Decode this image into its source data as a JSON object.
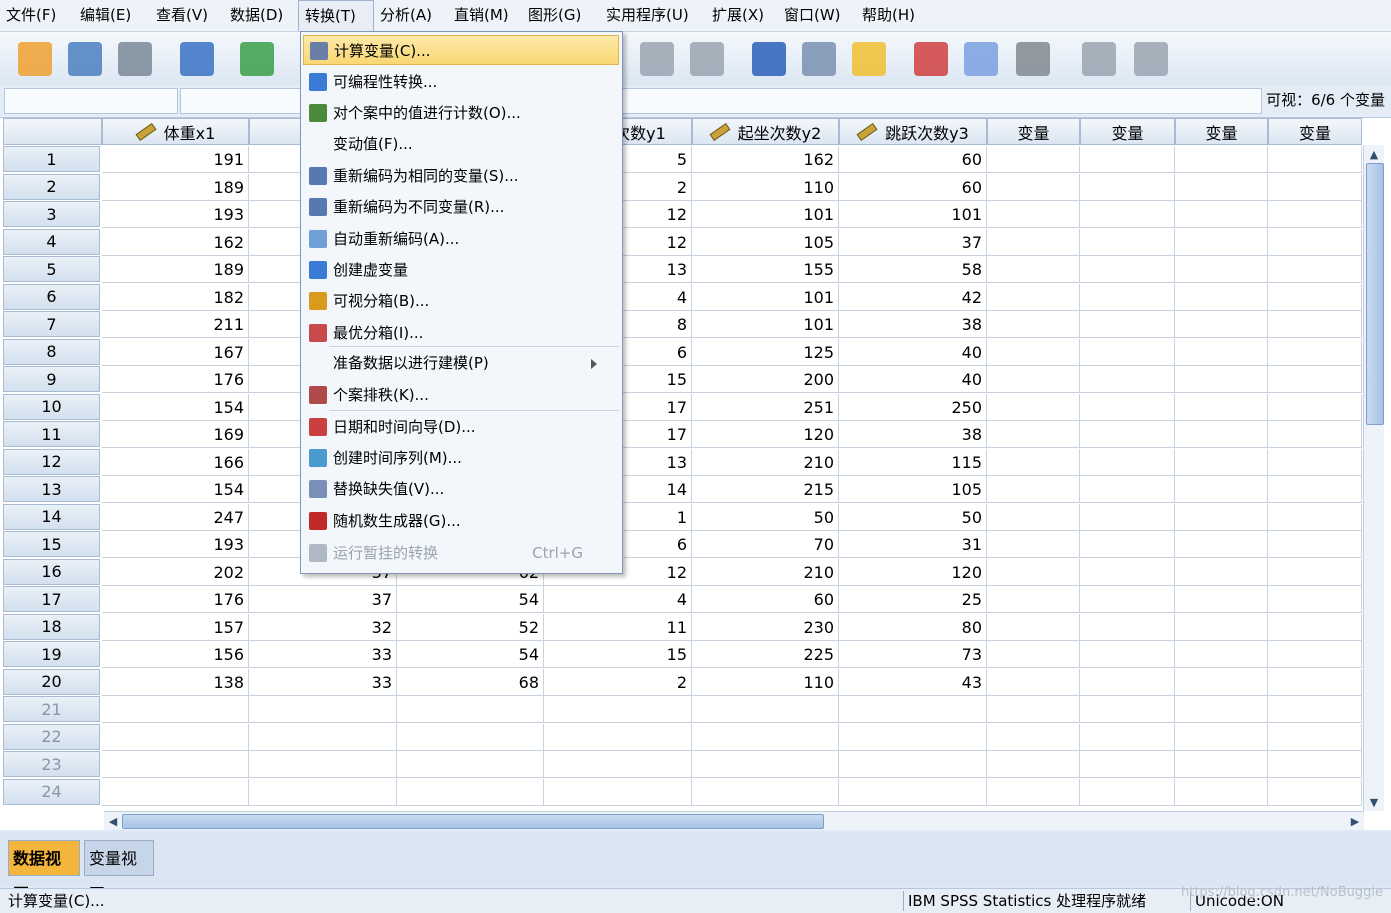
{
  "menubar": [
    {
      "label": "文件(F)"
    },
    {
      "label": "编辑(E)"
    },
    {
      "label": "查看(V)"
    },
    {
      "label": "数据(D)"
    },
    {
      "label": "转换(T)",
      "active": true
    },
    {
      "label": "分析(A)"
    },
    {
      "label": "直销(M)"
    },
    {
      "label": "图形(G)"
    },
    {
      "label": "实用程序(U)"
    },
    {
      "label": "扩展(X)"
    },
    {
      "label": "窗口(W)"
    },
    {
      "label": "帮助(H)"
    }
  ],
  "toolbar_icons": [
    "open-file-icon",
    "save-icon",
    "print-icon",
    "dialog-recall-icon",
    "undo-icon",
    "goto-case-icon",
    "goto-variable-icon",
    "variables-icon",
    "split-file-icon",
    "weight-cases-icon",
    "select-cases-icon",
    "value-labels-icon",
    "use-sets-icon",
    "show-all-icon",
    "spell-check-icon"
  ],
  "cellbar": {
    "visible_count": "可视：6/6 个变量"
  },
  "columns": [
    "体重x1",
    "",
    "",
    "上次数y1",
    "起坐次数y2",
    "跳跃次数y3",
    "变量",
    "变量",
    "变量",
    "变量"
  ],
  "rows": [
    [
      "191",
      "",
      "",
      "5",
      "162",
      "60"
    ],
    [
      "189",
      "",
      "",
      "2",
      "110",
      "60"
    ],
    [
      "193",
      "",
      "",
      "12",
      "101",
      "101"
    ],
    [
      "162",
      "",
      "",
      "12",
      "105",
      "37"
    ],
    [
      "189",
      "",
      "",
      "13",
      "155",
      "58"
    ],
    [
      "182",
      "",
      "",
      "4",
      "101",
      "42"
    ],
    [
      "211",
      "",
      "",
      "8",
      "101",
      "38"
    ],
    [
      "167",
      "",
      "",
      "6",
      "125",
      "40"
    ],
    [
      "176",
      "",
      "",
      "15",
      "200",
      "40"
    ],
    [
      "154",
      "",
      "",
      "17",
      "251",
      "250"
    ],
    [
      "169",
      "",
      "",
      "17",
      "120",
      "38"
    ],
    [
      "166",
      "",
      "",
      "13",
      "210",
      "115"
    ],
    [
      "154",
      "",
      "",
      "14",
      "215",
      "105"
    ],
    [
      "247",
      "",
      "",
      "1",
      "50",
      "50"
    ],
    [
      "193",
      "",
      "",
      "6",
      "70",
      "31"
    ],
    [
      "202",
      "37",
      "62",
      "12",
      "210",
      "120"
    ],
    [
      "176",
      "37",
      "54",
      "4",
      "60",
      "25"
    ],
    [
      "157",
      "32",
      "52",
      "11",
      "230",
      "80"
    ],
    [
      "156",
      "33",
      "54",
      "15",
      "225",
      "73"
    ],
    [
      "138",
      "33",
      "68",
      "2",
      "110",
      "43"
    ]
  ],
  "empty_row_numbers": [
    "21",
    "22",
    "23",
    "24"
  ],
  "menu": {
    "items": [
      {
        "label": "计算变量(C)...",
        "icon": "calculator-icon",
        "color": "#6a7fa8",
        "highlight": true
      },
      {
        "label": "可编程性转换...",
        "icon": "plus-icon",
        "color": "#3a7bd5"
      },
      {
        "label": "对个案中的值进行计数(O)...",
        "icon": "count-icon",
        "color": "#4a8a3a"
      },
      {
        "label": "变动值(F)...",
        "icon": ""
      },
      {
        "label": "重新编码为相同的变量(S)...",
        "icon": "recode-same-icon",
        "color": "#5878b0"
      },
      {
        "label": "重新编码为不同变量(R)...",
        "icon": "recode-different-icon",
        "color": "#5878b0"
      },
      {
        "label": "自动重新编码(A)...",
        "icon": "auto-recode-icon",
        "color": "#6fa0d8"
      },
      {
        "label": "创建虚变量",
        "icon": "plus-icon",
        "color": "#3a7bd5"
      },
      {
        "label": "可视分箱(B)...",
        "icon": "visual-binning-icon",
        "color": "#d99a1d"
      },
      {
        "label": "最优分箱(I)...",
        "icon": "optimal-binning-icon",
        "color": "#c94a4a"
      },
      {
        "label": "准备数据以进行建模(P)",
        "icon": "",
        "submenu": true
      },
      {
        "label": "个案排秩(K)...",
        "icon": "rank-cases-icon",
        "color": "#b04a4a"
      },
      {
        "label": "日期和时间向导(D)...",
        "icon": "calendar-icon",
        "color": "#c94040"
      },
      {
        "label": "创建时间序列(M)...",
        "icon": "time-series-icon",
        "color": "#4a9ad0"
      },
      {
        "label": "替换缺失值(V)...",
        "icon": "replace-missing-icon",
        "color": "#7a8fb8"
      },
      {
        "label": "随机数生成器(G)...",
        "icon": "dice-icon",
        "color": "#c22a2a"
      },
      {
        "label": "运行暂挂的转换",
        "icon": "run-pending-icon",
        "color": "#b0b8c4",
        "shortcut": "Ctrl+G",
        "disabled": true
      }
    ]
  },
  "tabs": {
    "data_view": "数据视图",
    "variable_view": "变量视图"
  },
  "status": {
    "left": "计算变量(C)...",
    "processor": "IBM SPSS Statistics 处理程序就绪",
    "unicode": "Unicode:ON"
  },
  "watermark": "https://blog.csdn.net/NoBuggie"
}
